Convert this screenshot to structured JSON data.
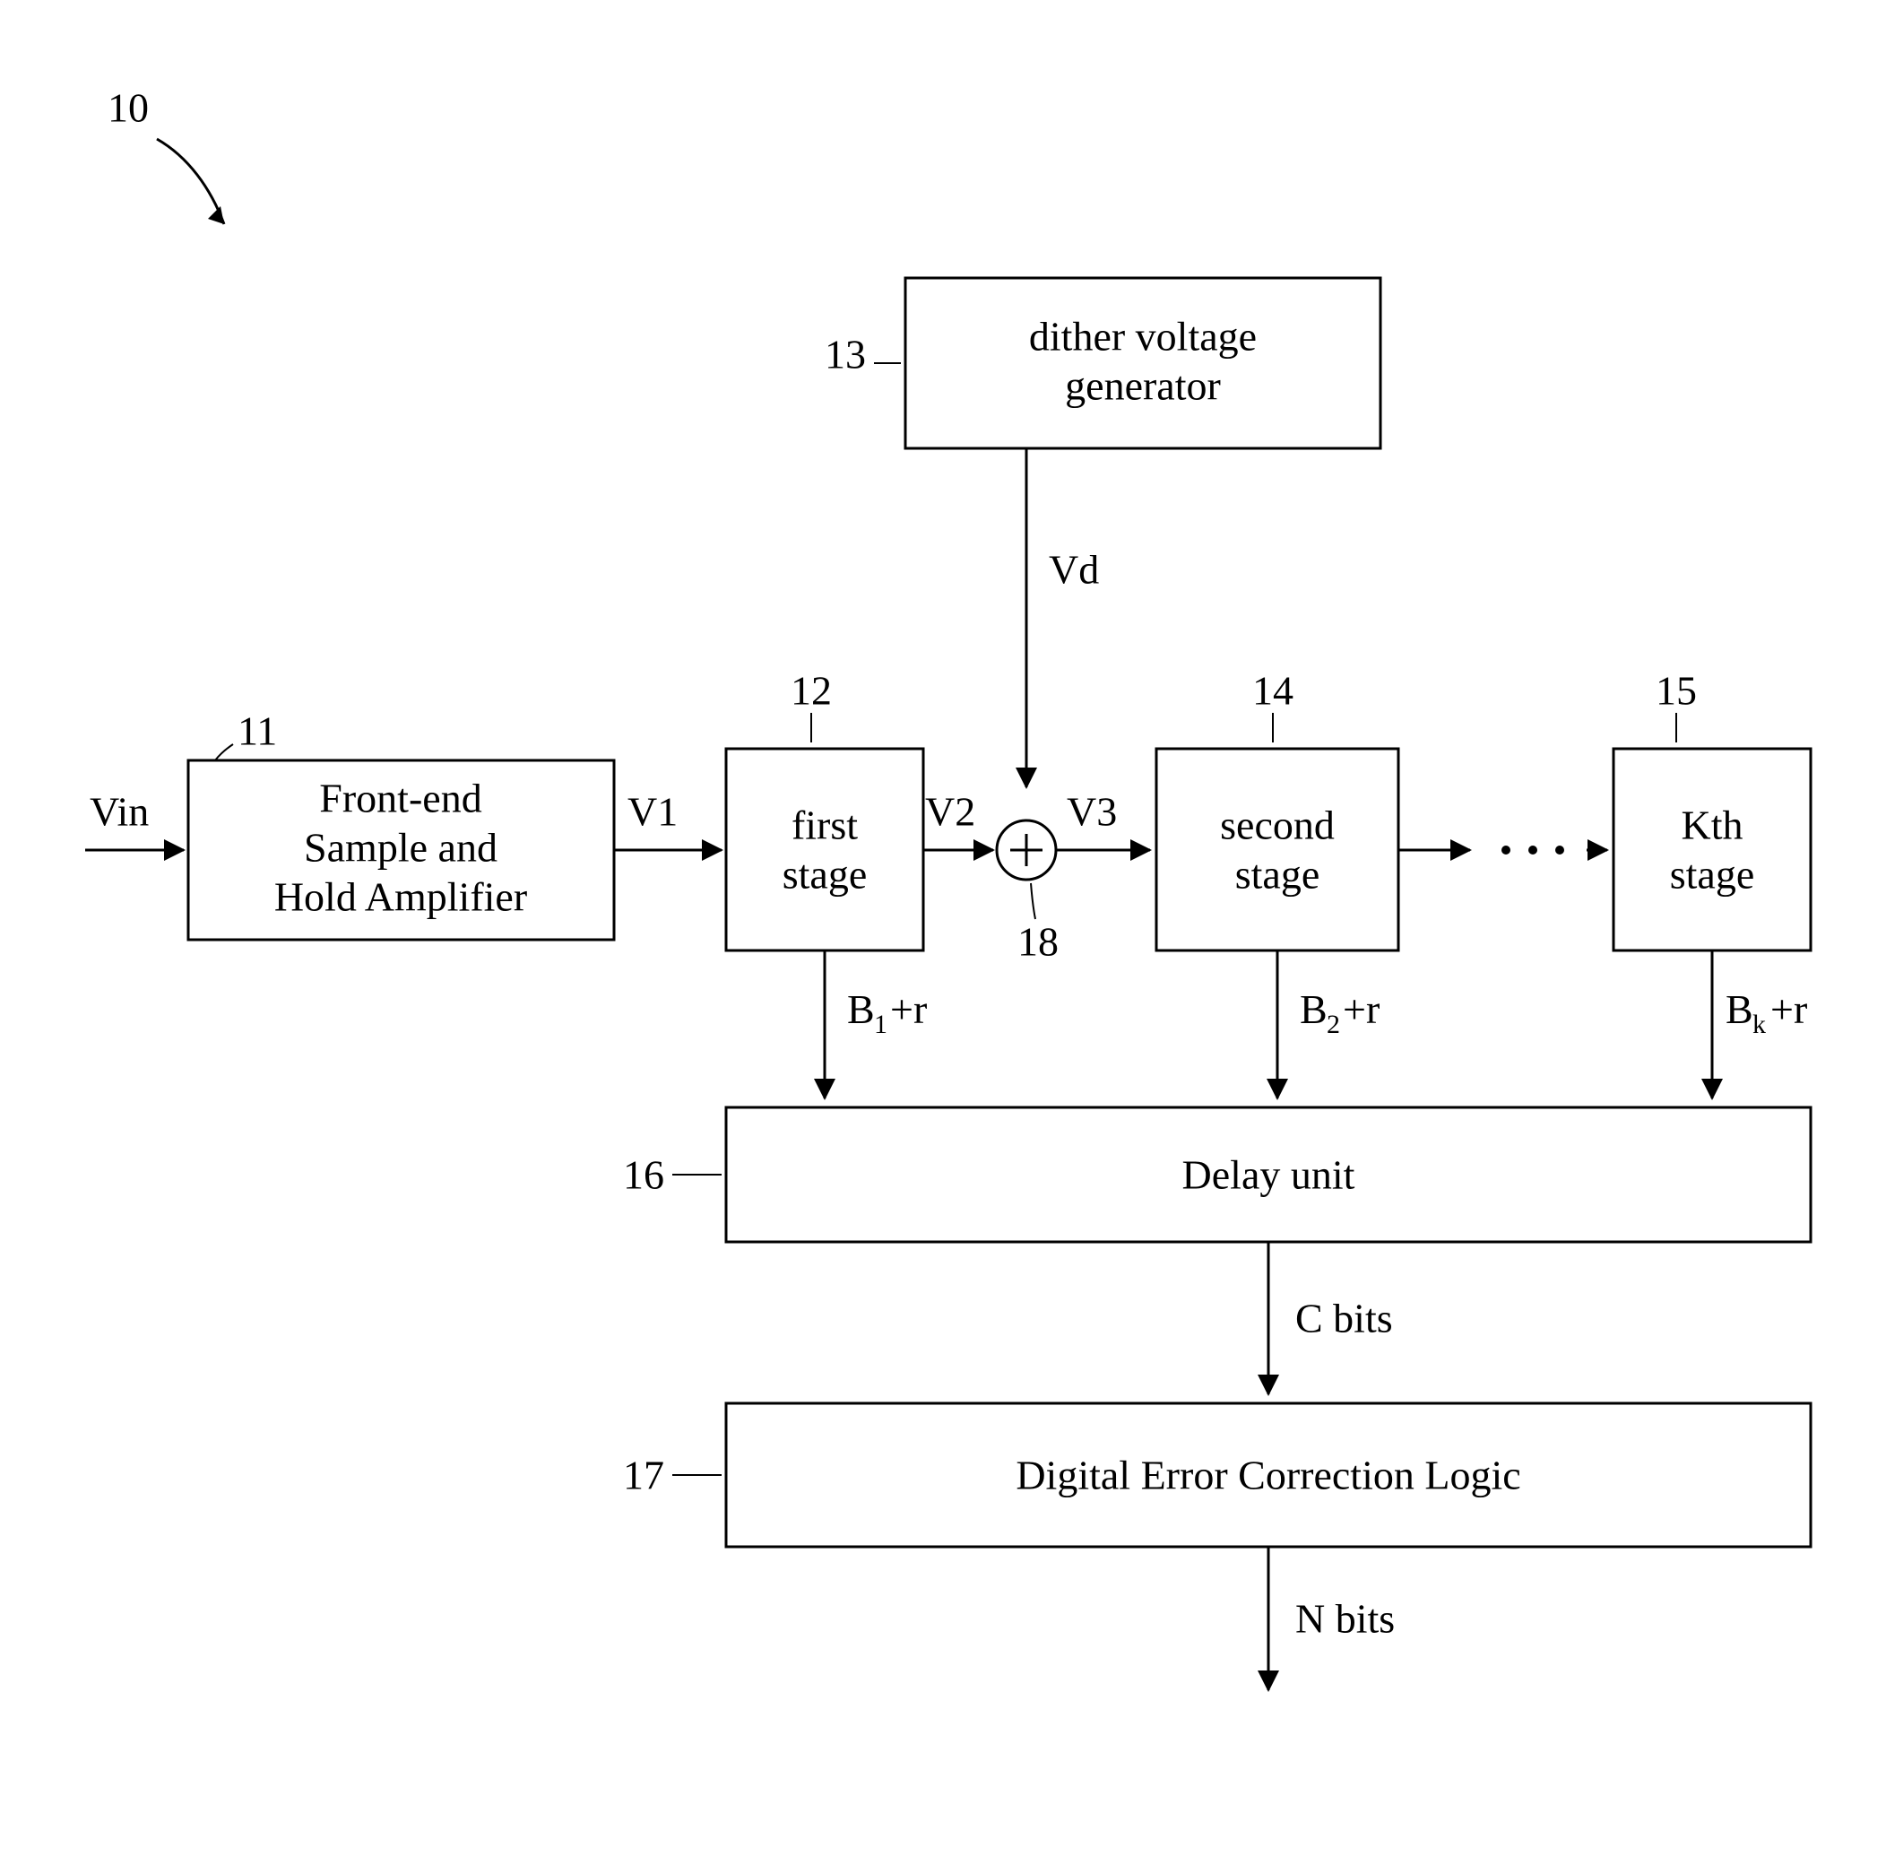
{
  "figNum": "10",
  "blocks": {
    "b11": {
      "label": "Front-end\nSample and\nHold Amplifier",
      "ref": "11"
    },
    "b12": {
      "label": "first\nstage",
      "ref": "12"
    },
    "b13": {
      "label": "dither voltage\ngenerator",
      "ref": "13"
    },
    "b14": {
      "label": "second\nstage",
      "ref": "14"
    },
    "b15": {
      "label": "Kth\nstage",
      "ref": "15"
    },
    "b16": {
      "label": "Delay unit",
      "ref": "16"
    },
    "b17": {
      "label": "Digital Error Correction Logic",
      "ref": "17"
    },
    "b18": {
      "ref": "18"
    }
  },
  "signals": {
    "Vin": "Vin",
    "V1": "V1",
    "V2": "V2",
    "V3": "V3",
    "Vd": "Vd",
    "B1": "B",
    "B1s": "1",
    "Br": "+r",
    "B2": "B",
    "B2s": "2",
    "Bk": "B",
    "Bks": "k",
    "C": "C bits",
    "N": "N bits"
  }
}
